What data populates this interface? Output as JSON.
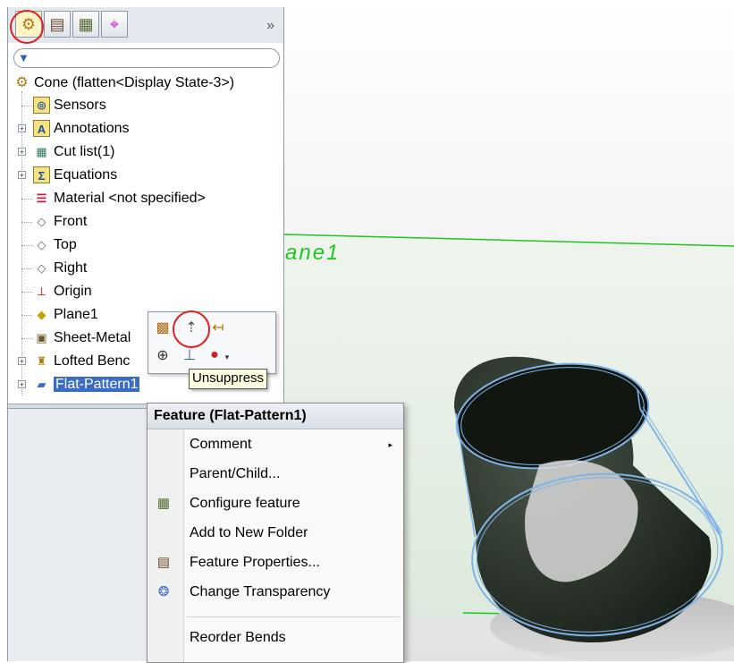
{
  "tree": {
    "tabs": [
      {
        "name": "featuremanager-tab",
        "icon": "featuremanager-icon",
        "glyph": "⚙"
      },
      {
        "name": "propertymanager-tab",
        "icon": "propertymanager-icon",
        "glyph": "▤"
      },
      {
        "name": "configurationmanager-tab",
        "icon": "configurationmanager-icon",
        "glyph": "▦"
      },
      {
        "name": "dimxpert-tab",
        "icon": "dimxpert-icon",
        "glyph": "⌖"
      }
    ],
    "expand_glyph": "»",
    "filter_glyph": "▼",
    "root_label": "Cone  (flatten<Display State-3>)",
    "items": [
      {
        "label": "Sensors"
      },
      {
        "label": "Annotations"
      },
      {
        "label": "Cut list(1)"
      },
      {
        "label": "Equations"
      },
      {
        "label": "Material <not specified>"
      },
      {
        "label": "Front"
      },
      {
        "label": "Top"
      },
      {
        "label": "Right"
      },
      {
        "label": "Origin"
      },
      {
        "label": "Plane1"
      },
      {
        "label": "Sheet-Metal"
      },
      {
        "label": "Lofted Benc"
      },
      {
        "label": "Flat-Pattern1"
      }
    ]
  },
  "viewport": {
    "plane_label": "ane1",
    "plane_color": "#22c422",
    "cone_color": "#1f2a20",
    "edge_color": "#7fb4e8"
  },
  "mini_toolbar": {
    "tooltip": "Unsuppress"
  },
  "context_menu": {
    "title": "Feature (Flat-Pattern1)",
    "items": [
      {
        "label": "Comment",
        "has_submenu": true,
        "submenu_glyph": "▸"
      },
      {
        "label": "Parent/Child..."
      },
      {
        "label": "Configure feature",
        "icon": "configure-feature-icon"
      },
      {
        "label": "Add to New Folder"
      },
      {
        "label": "Feature Properties...",
        "icon": "feature-properties-icon"
      },
      {
        "label": "Change Transparency",
        "icon": "change-transparency-icon"
      },
      {
        "label": "Reorder Bends"
      }
    ]
  }
}
